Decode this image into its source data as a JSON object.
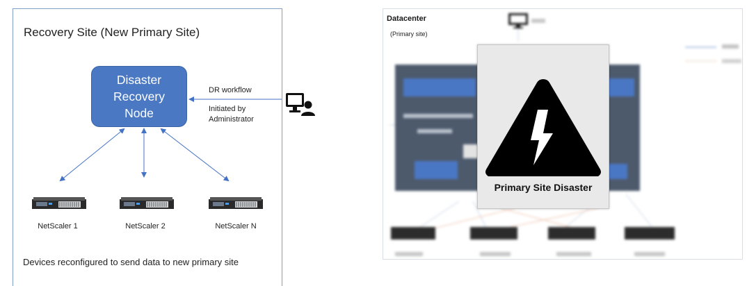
{
  "left": {
    "title": "Recovery Site (New Primary Site)",
    "node_lines": [
      "Disaster",
      "Recovery",
      "Node"
    ],
    "workflow_label": "DR workflow",
    "initiated_line1": "Initiated by",
    "initiated_line2": "Administrator",
    "appliances": [
      "NetScaler 1",
      "NetScaler 2",
      "NetScaler N"
    ],
    "footer": "Devices reconfigured to send data to new primary site"
  },
  "right": {
    "title": "Datacenter",
    "subtitle": "(Primary site)",
    "disaster_label": "Primary Site Disaster"
  },
  "colors": {
    "node_blue": "#4a78c2",
    "arrow": "#4472c4",
    "panel_border": "#7f9fc8",
    "dark_box": "#4d5a6c"
  },
  "icons": [
    "admin-workstation-icon",
    "server-appliance-icon",
    "lightning-warning-icon",
    "monitor-icon"
  ]
}
